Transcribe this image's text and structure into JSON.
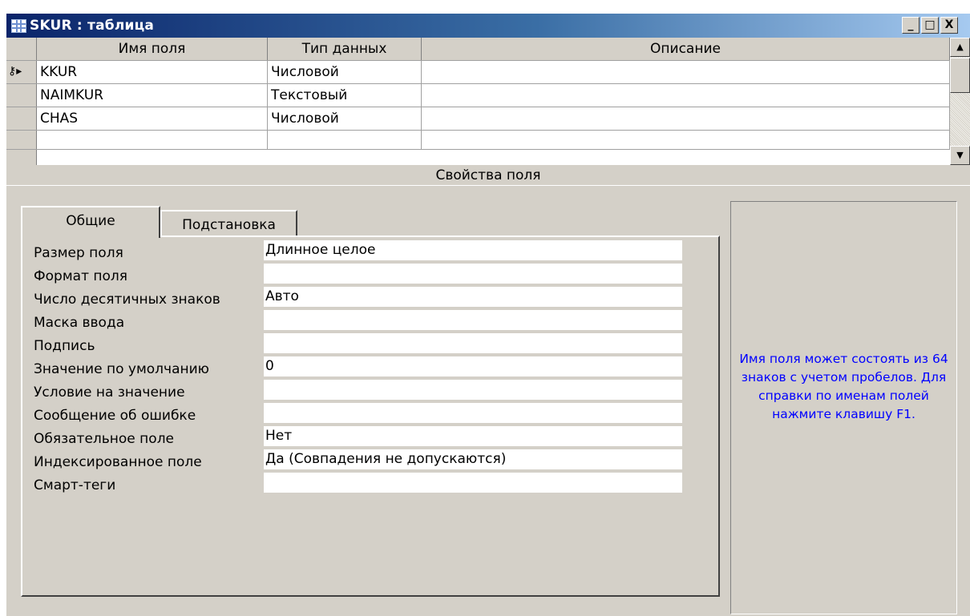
{
  "window": {
    "title": "SKUR : таблица",
    "minimize": "_",
    "maximize": "□",
    "close": "X"
  },
  "grid": {
    "headers": [
      "Имя поля",
      "Тип данных",
      "Описание"
    ],
    "rows": [
      {
        "name": "KKUR",
        "type": "Числовой",
        "description": "",
        "primary_key": true
      },
      {
        "name": "NAIMKUR",
        "type": "Текстовый",
        "description": ""
      },
      {
        "name": "CHAS",
        "type": "Числовой",
        "description": ""
      },
      {
        "name": "",
        "type": "",
        "description": ""
      }
    ]
  },
  "properties_section": "Свойства поля",
  "tabs": [
    {
      "label": "Общие",
      "active": true
    },
    {
      "label": "Подстановка",
      "active": false
    }
  ],
  "properties": [
    {
      "label": "Размер поля",
      "value": "Длинное целое"
    },
    {
      "label": "Формат поля",
      "value": ""
    },
    {
      "label": "Число десятичных знаков",
      "value": "Авто"
    },
    {
      "label": "Маска ввода",
      "value": ""
    },
    {
      "label": "Подпись",
      "value": ""
    },
    {
      "label": "Значение по умолчанию",
      "value": "0"
    },
    {
      "label": "Условие на значение",
      "value": ""
    },
    {
      "label": "Сообщение об ошибке",
      "value": ""
    },
    {
      "label": "Обязательное поле",
      "value": "Нет"
    },
    {
      "label": "Индексированное поле",
      "value": "Да (Совпадения не допускаются)"
    },
    {
      "label": "Смарт-теги",
      "value": ""
    }
  ],
  "help_text": "Имя поля может состоять из 64 знаков с учетом пробелов.  Для справки по именам полей нажмите клавишу F1.",
  "colors": {
    "title_start": "#0a246a",
    "title_end": "#a6caf0",
    "help_text": "#0000ff",
    "face": "#d4d0c8"
  }
}
